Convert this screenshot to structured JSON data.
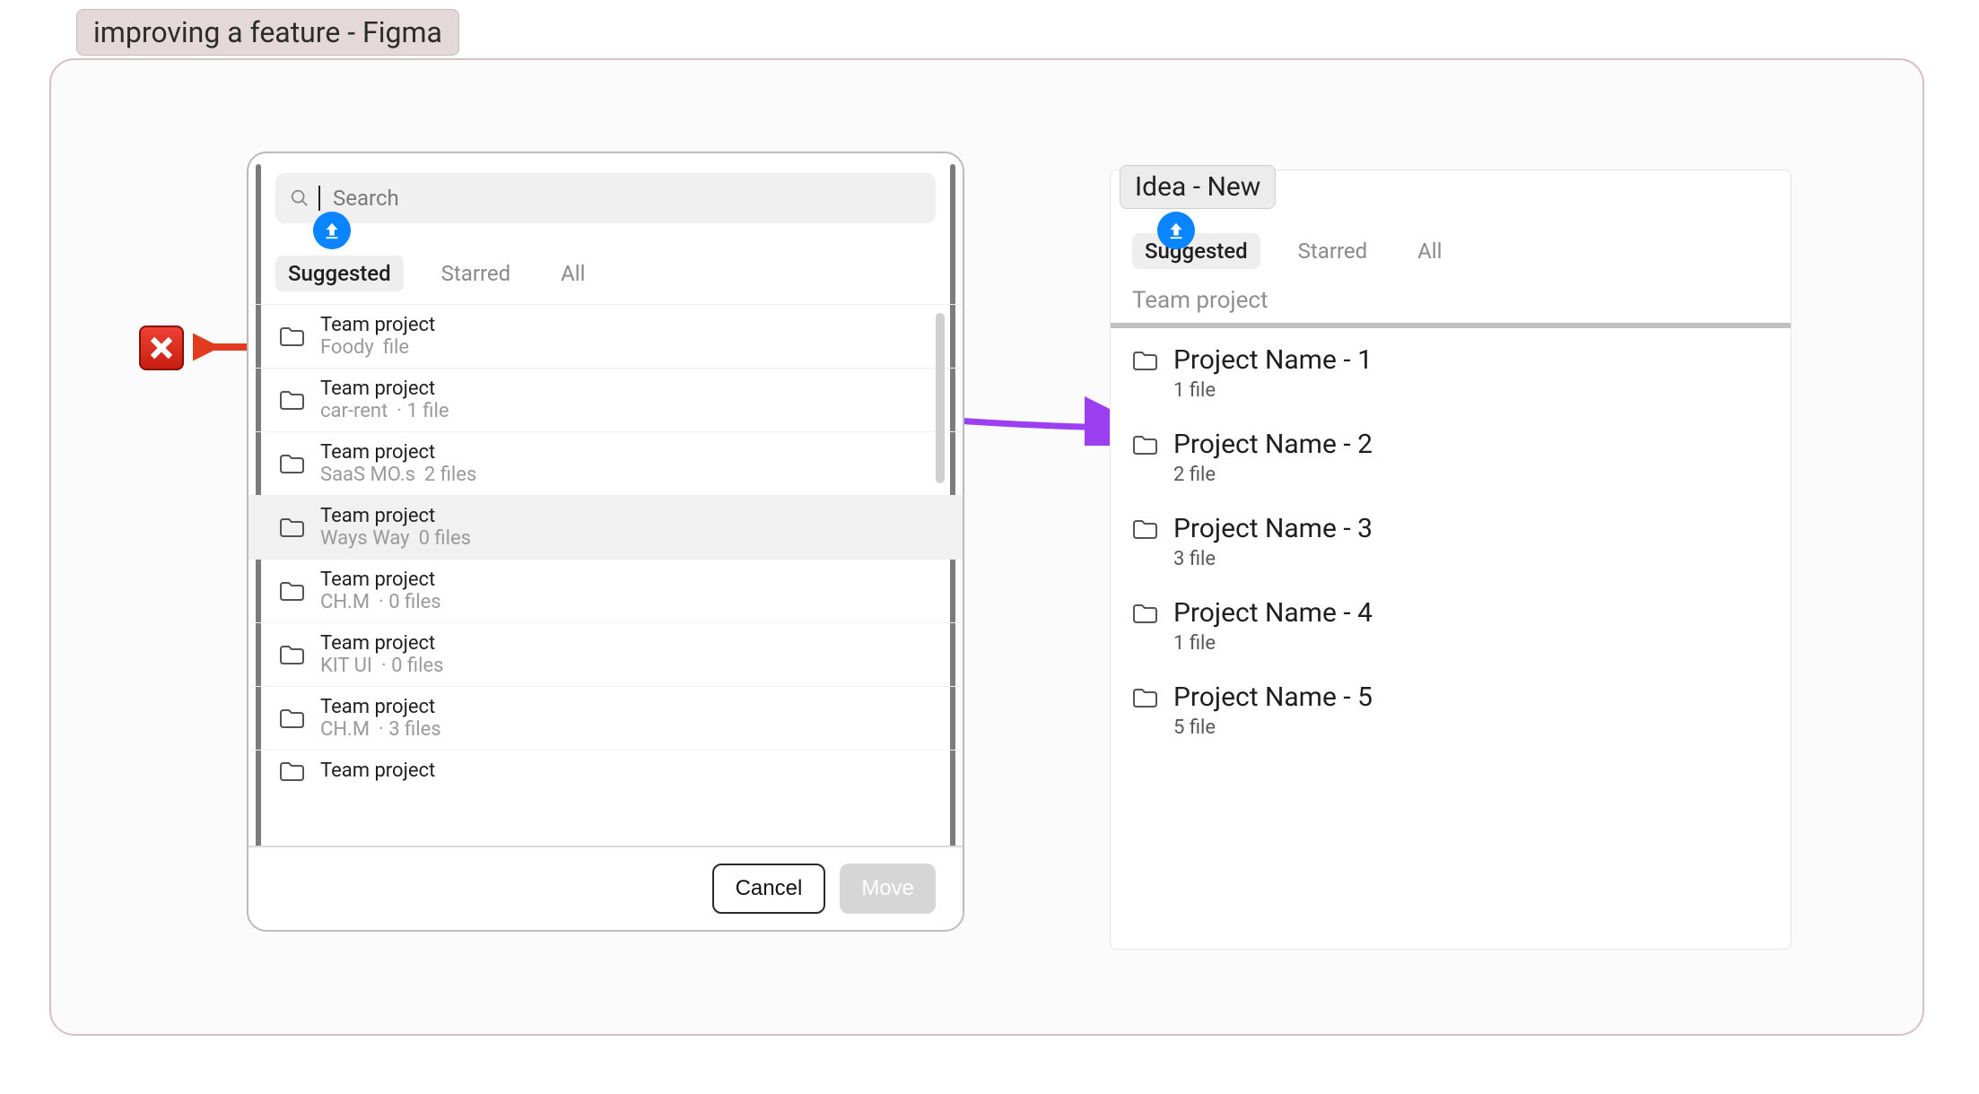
{
  "page_title": "improving a feature - Figma",
  "panel_a": {
    "search_placeholder": "Search",
    "tabs": {
      "suggested": "Suggested",
      "starred": "Starred",
      "all": "All"
    },
    "rows": [
      {
        "team": "Team project",
        "name": "Foody",
        "meta": "file"
      },
      {
        "team": "Team project",
        "name": "car-rent",
        "meta": "· 1 file"
      },
      {
        "team": "Team project",
        "name": "SaaS MO.s",
        "meta": "2 files"
      },
      {
        "team": "Team project",
        "name": "Ways Way",
        "meta": "0 files",
        "hover": true
      },
      {
        "team": "Team project",
        "name": "CH.M",
        "meta": "· 0 files"
      },
      {
        "team": "Team project",
        "name": "KIT UI",
        "meta": "· 0 files"
      },
      {
        "team": "Team project",
        "name": "CH.M",
        "meta": "· 3 files"
      },
      {
        "team": "Team project",
        "name": "",
        "meta": ""
      }
    ],
    "footer": {
      "cancel": "Cancel",
      "move": "Move"
    }
  },
  "panel_b": {
    "badge": "Idea - New",
    "tabs": {
      "suggested": "Suggested",
      "starred": "Starred",
      "all": "All"
    },
    "section": "Team project",
    "rows": [
      {
        "name": "Project Name - 1",
        "meta": "1 file"
      },
      {
        "name": "Project Name - 2",
        "meta": "2 file"
      },
      {
        "name": "Project Name - 3",
        "meta": "3 file"
      },
      {
        "name": "Project Name - 4",
        "meta": "1 file"
      },
      {
        "name": "Project Name - 5",
        "meta": "5 file"
      }
    ]
  }
}
